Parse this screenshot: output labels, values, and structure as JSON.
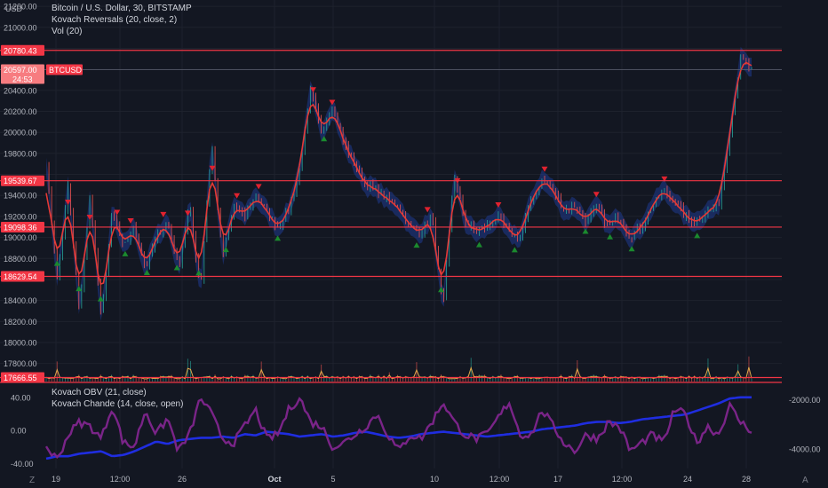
{
  "currency_label": "USD",
  "legend": {
    "line1": "Bitcoin / U.S. Dollar, 30, BITSTAMP",
    "line2": "Kovach Reversals (20, close, 2)",
    "line3": "Vol (20)"
  },
  "lower_legend": {
    "line1": "Kovach OBV (21, close)",
    "line2": "Kovach Chande (14, close, open)"
  },
  "price_axis_ticks": [
    "21200.00",
    "21000.00",
    "20800.00",
    "20600.00",
    "20400.00",
    "20200.00",
    "20000.00",
    "19800.00",
    "19600.00",
    "19400.00",
    "19200.00",
    "19000.00",
    "18800.00",
    "18600.00",
    "18400.00",
    "18200.00",
    "18000.00",
    "17800.00"
  ],
  "price_axis_values": [
    21200,
    21000,
    20800,
    20600,
    20400,
    20200,
    20000,
    19800,
    19600,
    19400,
    19200,
    19000,
    18800,
    18600,
    18400,
    18200,
    18000,
    17800
  ],
  "horizontal_levels": [
    {
      "label": "20780.43",
      "value": 20780.43
    },
    {
      "label": "19539.67",
      "value": 19539.67
    },
    {
      "label": "19098.36",
      "value": 19098.36
    },
    {
      "label": "18629.54",
      "value": 18629.54
    },
    {
      "label": "17666.55",
      "value": 17666.55
    }
  ],
  "current_price": {
    "value_label": "20597.00",
    "countdown": "24:53",
    "symbol": "BTCUSD",
    "value": 20597
  },
  "lower_left_ticks": [
    "40.00",
    "0.00",
    "-40.00"
  ],
  "lower_left_values": [
    40,
    0,
    -40
  ],
  "lower_right_ticks": [
    "-2000.00",
    "-4000.00"
  ],
  "time_axis_ticks": [
    "19",
    "12:00",
    "26",
    "Oct",
    "5",
    "10",
    "12:00",
    "17",
    "12:00",
    "24",
    "28"
  ],
  "bottom_buttons": {
    "left": "Z",
    "right": "A"
  },
  "colors": {
    "background": "#131722",
    "grid": "#1e222d",
    "level_line": "#f23645",
    "price_line": "#e53935",
    "candle_up": "#26a69a",
    "candle_down": "#ef5350",
    "band": "#1f3a8f",
    "buy_marker": "#1b8a2e",
    "sell_marker": "#e0222f",
    "obv": "#1f2de0",
    "chande": "#7a2488",
    "volume": "#e0a84a"
  },
  "chart_data": {
    "type": "line",
    "series": [
      {
        "values": [
          19700,
          18600,
          19500,
          18300,
          19400,
          18200,
          19250,
          18900,
          19100,
          18700,
          19000,
          19150,
          18700,
          19300,
          18500,
          19900,
          18800,
          19300,
          19200,
          19400,
          19250,
          19100,
          19250,
          19650,
          20400,
          20000,
          20250,
          19900,
          19700,
          19500,
          19450,
          19350,
          19300,
          19100,
          19050,
          19200,
          18300,
          19600,
          19150,
          19050,
          19100,
          19200,
          19050,
          19000,
          19350,
          19550,
          19450,
          19250,
          19300,
          19150,
          19300,
          19100,
          19200,
          19000,
          19100,
          19300,
          19450,
          19350,
          19200,
          19150,
          19250,
          19300,
          20000,
          20700,
          20600
        ]
      },
      {
        "values": [
          -20,
          -35,
          -5,
          10,
          5,
          -10,
          30,
          -15,
          -20,
          25,
          -5,
          15,
          -25,
          -5,
          40,
          20,
          -10,
          -15,
          5,
          25,
          -10,
          -5,
          25,
          40,
          10,
          5,
          -20,
          -15,
          -5,
          5,
          20,
          -5,
          -25,
          -5,
          -10,
          10,
          35,
          10,
          -5,
          -10,
          -5,
          15,
          35,
          -5,
          -5,
          25,
          5,
          -15,
          -25,
          -5,
          -10,
          10,
          5,
          -25,
          -15,
          -5,
          -15,
          25,
          20,
          -15,
          5,
          -5,
          30,
          10,
          0
        ]
      },
      {
        "values": [
          -4400,
          -4300,
          -4300,
          -4200,
          -4150,
          -4100,
          -4300,
          -4250,
          -4100,
          -3900,
          -3700,
          -3800,
          -3650,
          -3600,
          -3550,
          -3550,
          -3500,
          -3550,
          -3400,
          -3450,
          -3300,
          -3350,
          -3400,
          -3500,
          -3450,
          -3400,
          -3500,
          -3450,
          -3350,
          -3300,
          -3400,
          -3500,
          -3550,
          -3500,
          -3400,
          -3350,
          -3300,
          -3350,
          -3400,
          -3450,
          -3500,
          -3450,
          -3400,
          -3350,
          -3300,
          -3200,
          -3150,
          -3100,
          -3050,
          -2950,
          -2900,
          -2900,
          -2950,
          -2900,
          -2800,
          -2750,
          -2700,
          -2650,
          -2600,
          -2450,
          -2300,
          -2150,
          -1950,
          -1900,
          -1900
        ]
      }
    ],
    "ylim": [
      17620,
      21260
    ],
    "lower_left_ylim": [
      -46,
      55
    ],
    "lower_right_ylim": [
      -4800,
      -1400
    ],
    "x_ticks": [
      "19",
      "12:00",
      "26",
      "Oct",
      "5",
      "10",
      "12:00",
      "17",
      "12:00",
      "24",
      "28"
    ]
  }
}
